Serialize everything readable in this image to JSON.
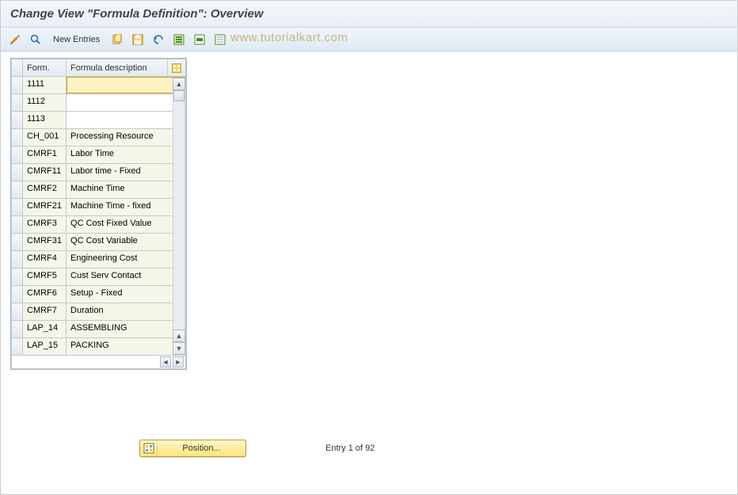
{
  "title": "Change View \"Formula Definition\": Overview",
  "watermark": "www.tutorialkart.com",
  "toolbar": {
    "new_entries_label": "New Entries"
  },
  "table": {
    "headers": {
      "form": "Form.",
      "desc": "Formula description"
    },
    "rows": [
      {
        "form": "1111",
        "desc": "",
        "ro": false,
        "active": true
      },
      {
        "form": "1112",
        "desc": "",
        "ro": false,
        "active": false
      },
      {
        "form": "1113",
        "desc": "",
        "ro": false,
        "active": false
      },
      {
        "form": "CH_001",
        "desc": "Processing Resource",
        "ro": true,
        "active": false
      },
      {
        "form": "CMRF1",
        "desc": "Labor Time",
        "ro": true,
        "active": false
      },
      {
        "form": "CMRF11",
        "desc": "Labor time - Fixed",
        "ro": true,
        "active": false
      },
      {
        "form": "CMRF2",
        "desc": "Machine Time",
        "ro": true,
        "active": false
      },
      {
        "form": "CMRF21",
        "desc": "Machine Time - fixed",
        "ro": true,
        "active": false
      },
      {
        "form": "CMRF3",
        "desc": "QC Cost Fixed Value",
        "ro": true,
        "active": false
      },
      {
        "form": "CMRF31",
        "desc": "QC Cost Variable",
        "ro": true,
        "active": false
      },
      {
        "form": "CMRF4",
        "desc": "Engineering Cost",
        "ro": true,
        "active": false
      },
      {
        "form": "CMRF5",
        "desc": "Cust Serv Contact",
        "ro": true,
        "active": false
      },
      {
        "form": "CMRF6",
        "desc": "Setup - Fixed",
        "ro": true,
        "active": false
      },
      {
        "form": "CMRF7",
        "desc": "Duration",
        "ro": true,
        "active": false
      },
      {
        "form": "LAP_14",
        "desc": "ASSEMBLING",
        "ro": true,
        "active": false
      },
      {
        "form": "LAP_15",
        "desc": "PACKING",
        "ro": true,
        "active": false
      }
    ]
  },
  "footer": {
    "position_label": "Position...",
    "entry_text": "Entry 1 of 92"
  }
}
